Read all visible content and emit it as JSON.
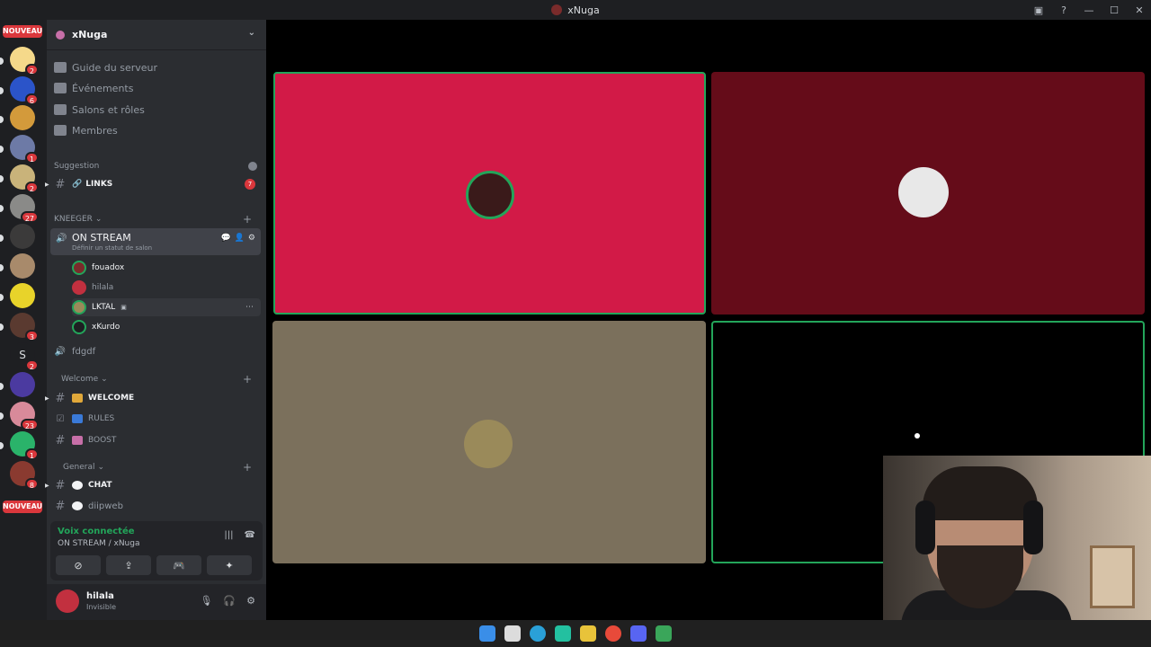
{
  "window": {
    "title": "xNuga"
  },
  "server_rail": {
    "top_badge": "NOUVEAU",
    "bottom_badge": "NOUVEAU",
    "servers": [
      {
        "badge": "2",
        "color": "#f5d98a"
      },
      {
        "badge": "6",
        "color": "#2b54c9"
      },
      {
        "badge": "",
        "color": "#d39a3b"
      },
      {
        "badge": "1",
        "color": "#6d7aa6"
      },
      {
        "badge": "2",
        "color": "#c9b37a"
      },
      {
        "badge": "27",
        "color": "#8a8a88"
      },
      {
        "badge": "",
        "color": "#3b3a3a"
      },
      {
        "badge": "",
        "color": "#a88a6b"
      },
      {
        "badge": "",
        "color": "#e8d32a"
      },
      {
        "badge": "3",
        "color": "#5a3a30"
      },
      {
        "badge": "2",
        "letter": "S",
        "color": "#1e1f22"
      },
      {
        "badge": "",
        "color": "#4b3aa0"
      },
      {
        "badge": "23",
        "color": "#d88a9a"
      },
      {
        "badge": "1",
        "color": "#2ab36a"
      },
      {
        "badge": "8",
        "color": "#8a3a30"
      }
    ]
  },
  "sidebar": {
    "server_name": "xNuga",
    "nav": [
      {
        "label": "Guide du serveur"
      },
      {
        "label": "Événements"
      },
      {
        "label": "Salons et rôles"
      },
      {
        "label": "Membres"
      }
    ],
    "categories": {
      "suggestion": "Suggestion",
      "kneeger": "KNEEGER",
      "welcome": "Welcome",
      "general": "General"
    },
    "channels": {
      "links": {
        "name": "LINKS",
        "badge": "7"
      },
      "on_stream": {
        "name": "ON STREAM",
        "status": "Définir un statut de salon"
      },
      "fdgdf": {
        "name": "fdgdf"
      },
      "welcome": {
        "name": "WELCOME"
      },
      "rules": {
        "name": "RULES"
      },
      "boost": {
        "name": "BOOST"
      },
      "chat": {
        "name": "CHAT"
      },
      "diipweb": {
        "name": "diipweb"
      }
    },
    "voice_members": [
      {
        "name": "fouadox"
      },
      {
        "name": "hilala"
      },
      {
        "name": "LKTAL"
      },
      {
        "name": "xKurdo"
      }
    ],
    "voice_panel": {
      "status": "Voix connectée",
      "channel": "ON STREAM / xNuga"
    },
    "user": {
      "name": "hilala",
      "status": "Invisible"
    }
  },
  "stage": {
    "tiles": [
      {
        "bg": "#d21a47",
        "speaking": true
      },
      {
        "bg": "#650c19",
        "speaking": false
      },
      {
        "bg": "#7b705c",
        "speaking": false
      },
      {
        "bg": "#000000",
        "speaking": true
      }
    ]
  }
}
